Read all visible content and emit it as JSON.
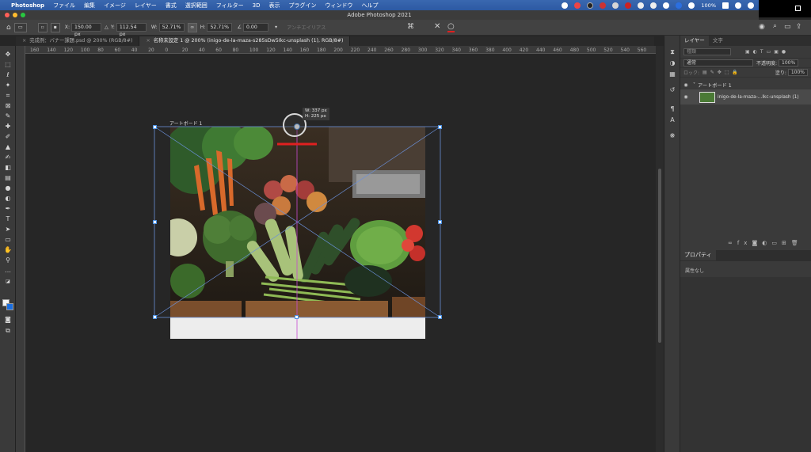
{
  "menubar": {
    "app": "Photoshop",
    "items": [
      "ファイル",
      "編集",
      "イメージ",
      "レイヤー",
      "書式",
      "選択範囲",
      "フィルター",
      "3D",
      "表示",
      "プラグイン",
      "ウィンドウ",
      "ヘルプ"
    ],
    "battery": "100%"
  },
  "titlebar": {
    "title": "Adobe Photoshop 2021"
  },
  "options": {
    "x_label": "X:",
    "x_value": "150.00 px",
    "y_label": "Y:",
    "y_value": "112.54 px",
    "w_label": "W:",
    "w_value": "52.71%",
    "h_label": "H:",
    "h_value": "52.71%",
    "angle_value": "0.00",
    "antialias_label": "アンチエイリアス"
  },
  "tabs": [
    {
      "label": "完成例：バナー課題.psd @ 200% (RGB/8#)"
    },
    {
      "label": "名称未設定 1 @ 200% (inigo-de-la-maza-s285sDw5Ikc-unsplash (1), RGB/8#)"
    }
  ],
  "ruler_labels": [
    "160",
    "140",
    "120",
    "100",
    "80",
    "60",
    "40",
    "20",
    "0",
    "20",
    "40",
    "60",
    "80",
    "100",
    "120",
    "140",
    "160",
    "180",
    "200",
    "220",
    "240",
    "260",
    "280",
    "300",
    "320",
    "340",
    "360",
    "380",
    "400",
    "420",
    "440",
    "460",
    "480",
    "500",
    "520",
    "540",
    "560"
  ],
  "canvas": {
    "artboard_label": "アートボード 1",
    "transform_tip_w": "W: 337 px",
    "transform_tip_h": "H: 225 px"
  },
  "layers_panel": {
    "tab_layers": "レイヤー",
    "tab_text": "文字",
    "search_placeholder": "種類",
    "blend_mode": "通常",
    "opacity_label": "不透明度:",
    "opacity_value": "100%",
    "lock_label": "ロック:",
    "fill_label": "塗り:",
    "fill_value": "100%",
    "artboard_name": "アートボード 1",
    "layer_name": "inigo-de-la-maza-...Ikc-unsplash (1)"
  },
  "properties_panel": {
    "tab": "プロパティ",
    "content": "属性なし"
  },
  "colors": {
    "accent": "#2d59a3",
    "handle": "#4a90e2",
    "red_mark": "#e02020"
  }
}
